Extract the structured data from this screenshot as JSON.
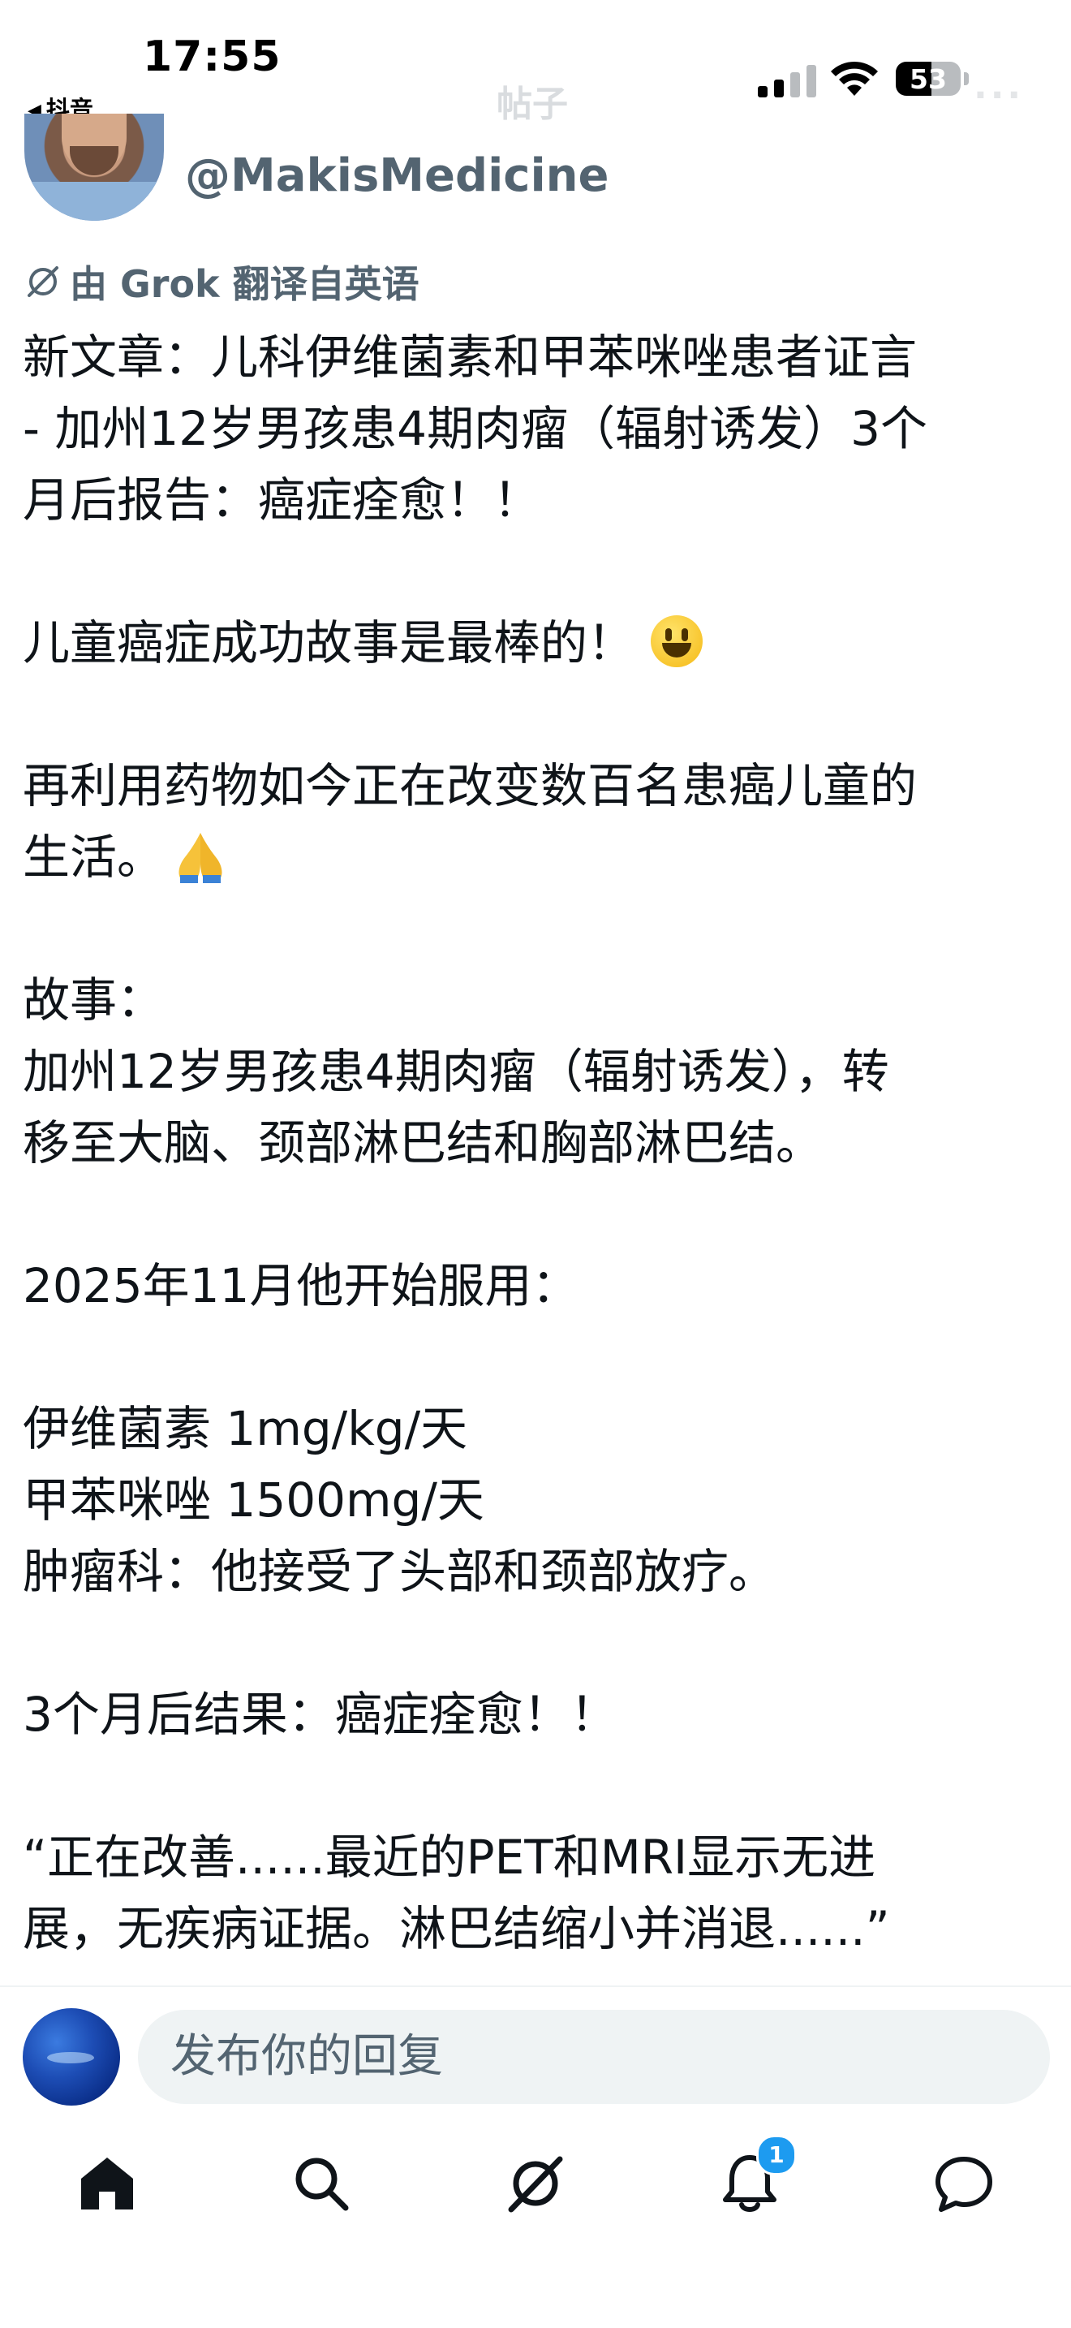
{
  "status_bar": {
    "time": "17:55",
    "back_app": "抖音",
    "faded_title": "帖子",
    "battery": "53"
  },
  "post": {
    "author_handle": "@MakisMedicine",
    "translation_note": "由 Grok 翻译自英语",
    "lines": [
      "新文章：儿科伊维菌素和甲苯咪唑患者证言",
      "- 加州12岁男孩患4期肉瘤（辐射诱发）3个",
      "月后报告：癌症痊愈！！",
      "儿童癌症成功故事是最棒的！",
      "再利用药物如今正在改变数百名患癌儿童的",
      "生活。",
      "故事：",
      "加州12岁男孩患4期肉瘤（辐射诱发），转",
      "移至大脑、颈部淋巴结和胸部淋巴结。",
      "2025年11月他开始服用：",
      "伊维菌素 1mg/kg/天",
      "甲苯咪唑 1500mg/天",
      "肿瘤科：他接受了头部和颈部放疗。",
      "3个月后结果：癌症痊愈！！",
      "“正在改善......最近的PET和MRI显示无进",
      "展，无疾病证据。淋巴结缩小并消退......”"
    ]
  },
  "reply": {
    "placeholder": "发布你的回复"
  },
  "bottom_nav": {
    "items": [
      "home-icon",
      "search-icon",
      "grok-icon",
      "notifications-icon",
      "messages-icon"
    ],
    "notification_count": "1"
  },
  "colors": {
    "accent": "#1d9bf0",
    "text": "#0f1419",
    "secondary_text": "#536471",
    "input_bg": "#eff3f4"
  }
}
